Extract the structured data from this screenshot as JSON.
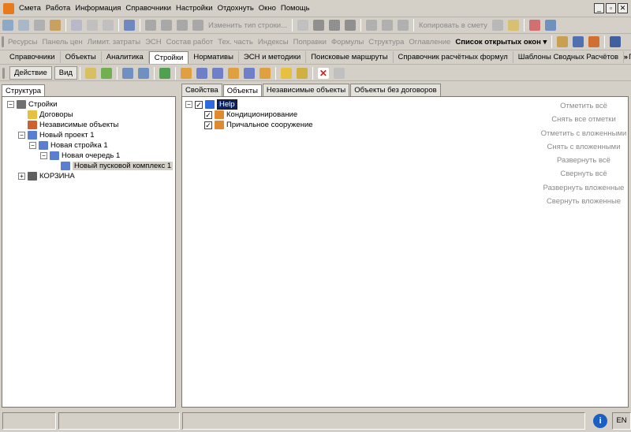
{
  "menu": [
    "Смета",
    "Работа",
    "Информация",
    "Справочники",
    "Настройки",
    "Отдохнуть",
    "Окно",
    "Помощь"
  ],
  "window_controls": [
    "_",
    "▫",
    "✕"
  ],
  "toolbar1": {
    "change_type": "Изменить тип строки...",
    "copy_to_estimate": "Копировать в смету"
  },
  "toolbar2": {
    "items": [
      "Ресурсы",
      "Панель цен",
      "Лимит. затраты",
      "ЭСН",
      "Состав работ",
      "Тех. часть",
      "Индексы",
      "Поправки",
      "Формулы",
      "Структура",
      "Оглавление"
    ],
    "open_windows": "Список открытых окон"
  },
  "main_tabs": [
    "Справочники",
    "Объекты",
    "Аналитика",
    "Стройки",
    "Нормативы",
    "ЭСН и методики",
    "Поисковые маршруты",
    "Справочник расчётных формул",
    "Шаблоны Сводных Расчётов",
    "Поправки"
  ],
  "main_tabs_more": "»",
  "toolbar3": {
    "action": "Действие",
    "view": "Вид"
  },
  "left_tab": "Структура",
  "left_tree": [
    {
      "label": "Стройки",
      "depth": 0,
      "exp": "−"
    },
    {
      "label": "Договоры",
      "depth": 1,
      "exp": ""
    },
    {
      "label": "Независимые объекты",
      "depth": 1,
      "exp": ""
    },
    {
      "label": "Новый проект 1",
      "depth": 1,
      "exp": "−"
    },
    {
      "label": "Новая стройка 1",
      "depth": 2,
      "exp": "−"
    },
    {
      "label": "Новая очередь 1",
      "depth": 3,
      "exp": "−"
    },
    {
      "label": "Новый пусковой комплекс 1",
      "depth": 4,
      "exp": ""
    },
    {
      "label": "КОРЗИНА",
      "depth": 1,
      "exp": "+"
    }
  ],
  "right_tabs": [
    "Свойства",
    "Объекты",
    "Независимые объекты",
    "Объекты без договоров"
  ],
  "right_tree": [
    {
      "label": "Help",
      "depth": 0
    },
    {
      "label": "Кондиционирование",
      "depth": 1
    },
    {
      "label": "Причальное сооружение",
      "depth": 1
    }
  ],
  "side_actions": [
    "Отметить всё",
    "Снять все отметки",
    "Отметить с вложенными",
    "Снять с вложенными",
    "Развернуть всё",
    "Свернуть всё",
    "Развернуть вложенные",
    "Свернуть вложенные"
  ],
  "status": {
    "lang": "EN",
    "info_icon": "i"
  }
}
